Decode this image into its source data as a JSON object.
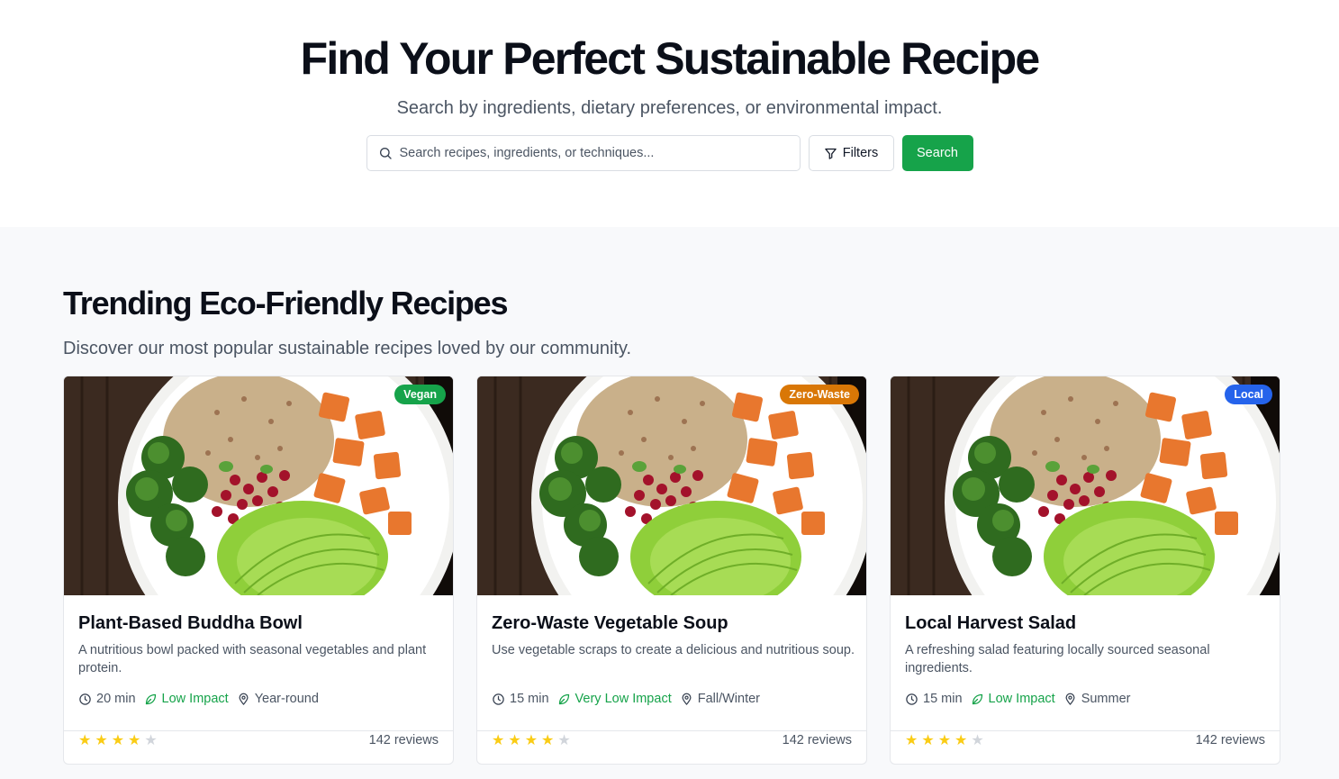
{
  "hero": {
    "title": "Find Your Perfect Sustainable Recipe",
    "subtitle": "Search by ingredients, dietary preferences, or environmental impact.",
    "search_placeholder": "Search recipes, ingredients, or techniques...",
    "filters_label": "Filters",
    "search_label": "Search",
    "icons": {
      "search": "search-icon",
      "filters": "filter-icon"
    }
  },
  "trending": {
    "title": "Trending Eco-Friendly Recipes",
    "subtitle": "Discover our most popular sustainable recipes loved by our community."
  },
  "colors": {
    "accent_green": "#16a34a",
    "badge_vegan": "#16a34a",
    "badge_zero_waste": "#d97706",
    "badge_local": "#2563eb",
    "star": "#facc15"
  },
  "cards": [
    {
      "badge": "Vegan",
      "badge_color": "#16a34a",
      "title": "Plant-Based Buddha Bowl",
      "description": "A nutritious bowl packed with seasonal vegetables and plant protein.",
      "time": "20 min",
      "impact": "Low Impact",
      "season": "Year-round",
      "rating": 4,
      "rating_max": 5,
      "reviews": "142 reviews"
    },
    {
      "badge": "Zero-Waste",
      "badge_color": "#d97706",
      "title": "Zero-Waste Vegetable Soup",
      "description": "Use vegetable scraps to create a delicious and nutritious soup.",
      "time": "15 min",
      "impact": "Very Low Impact",
      "season": "Fall/Winter",
      "rating": 4,
      "rating_max": 5,
      "reviews": "142 reviews"
    },
    {
      "badge": "Local",
      "badge_color": "#2563eb",
      "title": "Local Harvest Salad",
      "description": "A refreshing salad featuring locally sourced seasonal ingredients.",
      "time": "15 min",
      "impact": "Low Impact",
      "season": "Summer",
      "rating": 4,
      "rating_max": 5,
      "reviews": "142 reviews"
    }
  ]
}
